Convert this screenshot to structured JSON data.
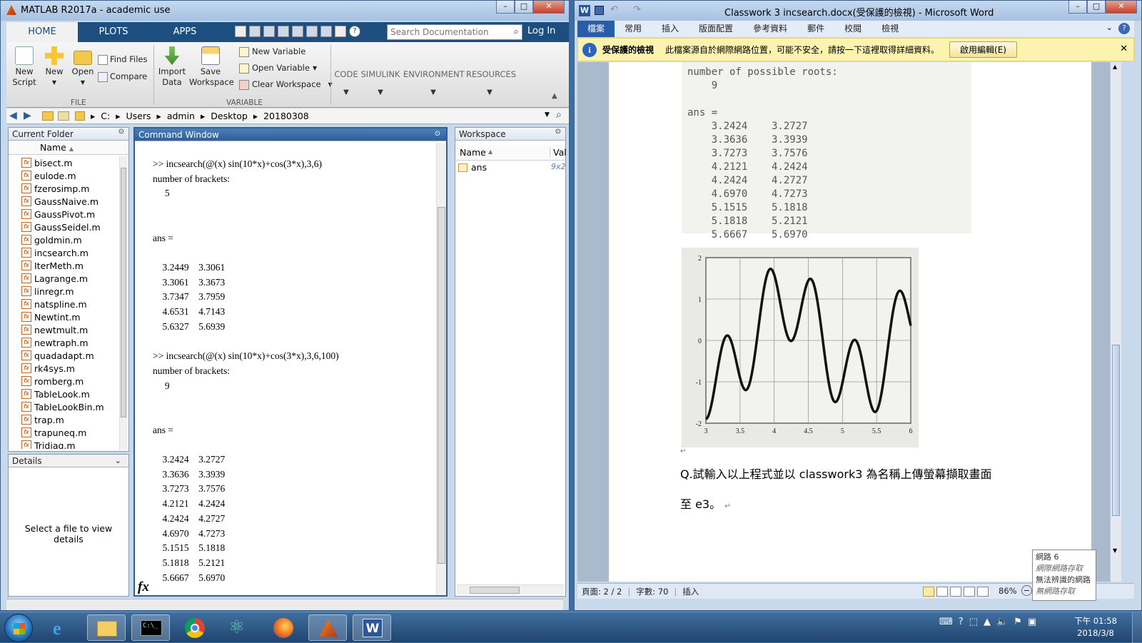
{
  "matlab": {
    "title": "MATLAB R2017a - academic use",
    "tabs": [
      "HOME",
      "PLOTS",
      "APPS"
    ],
    "search_placeholder": "Search Documentation",
    "login": "Log In",
    "ribbon": {
      "new_script": "New\nScript",
      "new": "New",
      "open": "Open",
      "find_files": "Find Files",
      "compare": "Compare",
      "import_data": "Import\nData",
      "save_workspace": "Save\nWorkspace",
      "new_variable": "New Variable",
      "open_variable": "Open Variable",
      "clear_workspace": "Clear Workspace",
      "code": "CODE",
      "simulink": "SIMULINK",
      "environment": "ENVIRONMENT",
      "resources": "RESOURCES",
      "group_file": "FILE",
      "group_variable": "VARIABLE"
    },
    "path": [
      "C:",
      "Users",
      "admin",
      "Desktop",
      "20180308"
    ],
    "current_folder": {
      "title": "Current Folder",
      "name_col": "Name",
      "files": [
        "bisect.m",
        "eulode.m",
        "fzerosimp.m",
        "GaussNaive.m",
        "GaussPivot.m",
        "GaussSeidel.m",
        "goldmin.m",
        "incsearch.m",
        "IterMeth.m",
        "Lagrange.m",
        "linregr.m",
        "natspline.m",
        "Newtint.m",
        "newtmult.m",
        "newtraph.m",
        "quadadapt.m",
        "rk4sys.m",
        "romberg.m",
        "TableLook.m",
        "TableLookBin.m",
        "trap.m",
        "trapuneq.m",
        "Tridiag.m"
      ]
    },
    "details": {
      "title": "Details",
      "empty_text": "Select a file to view details"
    },
    "command_window": {
      "title": "Command Window",
      "prompt_icon": "fx",
      "lines": [
        ">> incsearch(@(x) sin(10*x)+cos(3*x),3,6)",
        "number of brackets:",
        "     5",
        "",
        "",
        "ans =",
        "",
        "    3.2449    3.3061",
        "    3.3061    3.3673",
        "    3.7347    3.7959",
        "    4.6531    4.7143",
        "    5.6327    5.6939",
        "",
        ">> incsearch(@(x) sin(10*x)+cos(3*x),3,6,100)",
        "number of brackets:",
        "     9",
        "",
        "",
        "ans =",
        "",
        "    3.2424    3.2727",
        "    3.3636    3.3939",
        "    3.7273    3.7576",
        "    4.2121    4.2424",
        "    4.2424    4.2727",
        "    4.6970    4.7273",
        "    5.1515    5.1818",
        "    5.1818    5.2121",
        "    5.6667    5.6970"
      ]
    },
    "workspace": {
      "title": "Workspace",
      "col_name": "Name",
      "col_value": "Val",
      "rows": [
        {
          "name": "ans",
          "value": "9x2"
        }
      ]
    }
  },
  "word": {
    "title": "Classwork 3  incsearch.docx(受保護的檢視) - Microsoft Word",
    "tabs": [
      "檔案",
      "常用",
      "插入",
      "版面配置",
      "參考資料",
      "郵件",
      "校閱",
      "檢視"
    ],
    "protected_label": "受保護的檢視",
    "protected_message": "此檔案源自於網際網路位置，可能不安全，請按一下這裡取得詳細資料。",
    "enable_editing": "啟用編輯(E)",
    "scan_text": "number of possible roots:\n    9\n\nans =\n    3.2424    3.2727\n    3.3636    3.3939\n    3.7273    3.7576\n    4.2121    4.2424\n    4.2424    4.2727\n    4.6970    4.7273\n    5.1515    5.1818\n    5.1818    5.2121\n    5.6667    5.6970",
    "question_line1": "Q.試輸入以上程式並以 classwork3 為名稱上傳螢幕擷取畫面",
    "question_line2": "至 e3。",
    "status": {
      "page": "頁面: 2 / 2",
      "words": "字數: 70",
      "mode": "插入",
      "zoom": "86%"
    }
  },
  "network_tooltip": {
    "line1": "網路  6",
    "line2": "網際網路存取",
    "line3": "無法辨識的網路",
    "line4": "無網路存取"
  },
  "clock": {
    "time": "下午 01:58",
    "date": "2018/3/8"
  },
  "chart_data": {
    "type": "line",
    "x_ticks": [
      "3",
      "3.5",
      "4",
      "4.5",
      "5",
      "5.5",
      "6"
    ],
    "y_ticks": [
      "-2",
      "-1",
      "0",
      "1",
      "2"
    ],
    "xlim": [
      3,
      6
    ],
    "ylim": [
      -2,
      2
    ],
    "function": "sin(10*x)+cos(3*x)",
    "grid": true
  }
}
